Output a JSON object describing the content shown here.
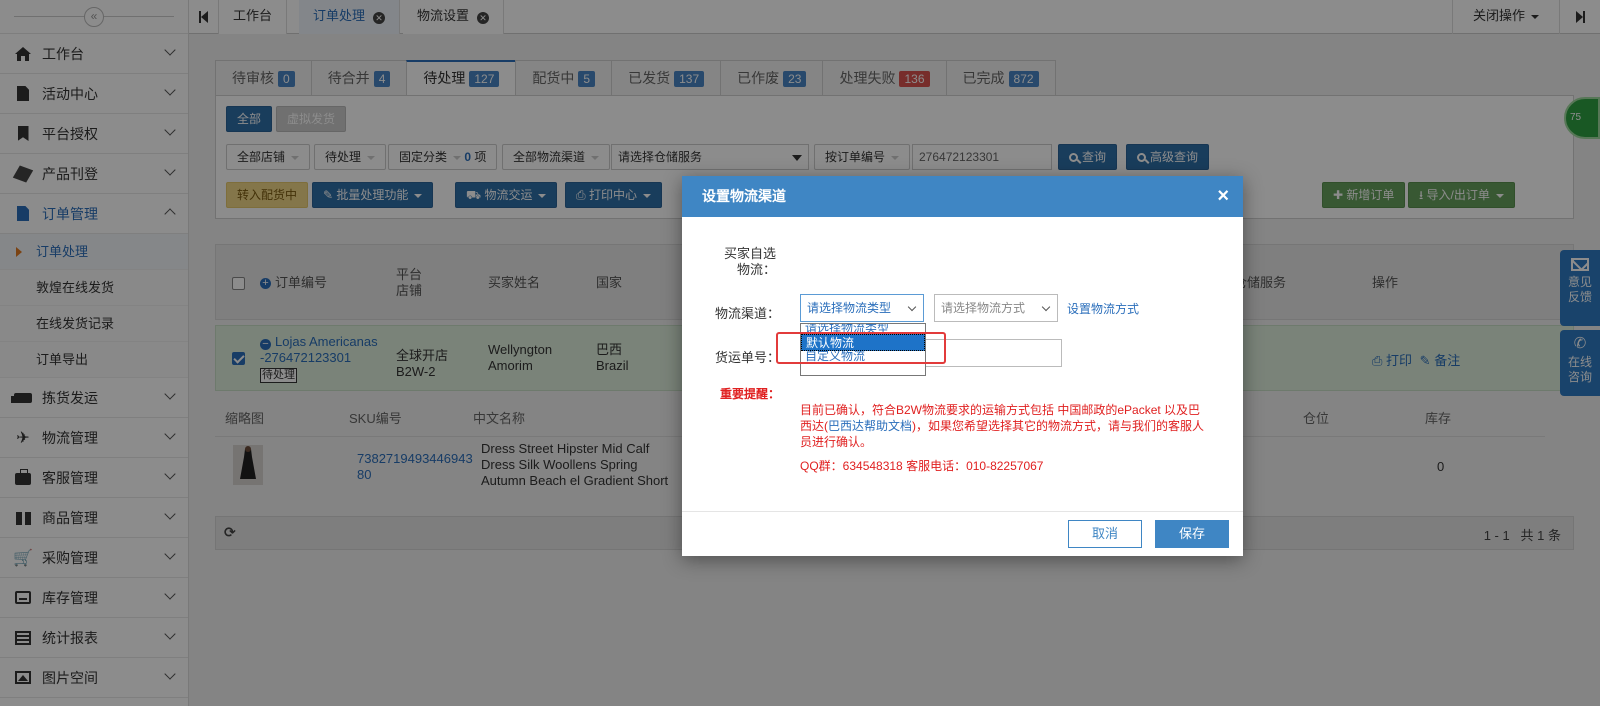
{
  "sidebar": {
    "items": [
      {
        "label": "工作台",
        "icon": "home-icon"
      },
      {
        "label": "活动中心",
        "icon": "document-icon"
      },
      {
        "label": "平台授权",
        "icon": "bookmark-icon"
      },
      {
        "label": "产品刊登",
        "icon": "cube-icon"
      },
      {
        "label": "订单管理",
        "icon": "document-icon"
      },
      {
        "label": "拣货发运",
        "icon": "truck-icon"
      },
      {
        "label": "物流管理",
        "icon": "plane-icon"
      },
      {
        "label": "客服管理",
        "icon": "briefcase-icon"
      },
      {
        "label": "商品管理",
        "icon": "gift-icon"
      },
      {
        "label": "采购管理",
        "icon": "cart-icon"
      },
      {
        "label": "库存管理",
        "icon": "inbox-icon"
      },
      {
        "label": "统计报表",
        "icon": "list-icon"
      },
      {
        "label": "图片空间",
        "icon": "image-icon"
      }
    ],
    "subitems": [
      "订单处理",
      "敦煌在线发货",
      "在线发货记录",
      "订单导出"
    ]
  },
  "topbar": {
    "tabs": [
      "工作台",
      "订单处理",
      "物流设置"
    ],
    "close_ops": "关闭操作"
  },
  "status_tabs": [
    {
      "label": "待审核",
      "count": "0"
    },
    {
      "label": "待合并",
      "count": "4"
    },
    {
      "label": "待处理",
      "count": "127"
    },
    {
      "label": "配货中",
      "count": "5"
    },
    {
      "label": "已发货",
      "count": "137"
    },
    {
      "label": "已作废",
      "count": "23"
    },
    {
      "label": "处理失败",
      "count": "136"
    },
    {
      "label": "已完成",
      "count": "872"
    }
  ],
  "filters": {
    "all": "全部",
    "virtual": "虚拟发货",
    "all_stores": "全部店铺",
    "pending": "待处理",
    "fixed_category": "固定分类",
    "fixed_count": "0",
    "fixed_unit": "项",
    "all_channels": "全部物流渠道",
    "warehouse": "请选择仓储服务",
    "by_order": "按订单编号",
    "order_value": "276472123301",
    "query": "查询",
    "advanced": "高级查询"
  },
  "actions": {
    "to_allocation": "转入配货中",
    "batch": "批量处理功能",
    "logistics": "物流交运",
    "print": "打印中心",
    "new_order": "新增订单",
    "import_export": "导入/出订单"
  },
  "table": {
    "headers": {
      "order_no": "订单编号",
      "platform": "平台\n店铺",
      "buyer": "买家姓名",
      "country": "国家",
      "warehouse": "仓储服务",
      "ops": "操作"
    },
    "row": {
      "store": "Lojas Americanas",
      "order_id": "-276472123301",
      "status": "待处理",
      "shop": "全球开店B2W-2",
      "buyer": "Wellyngton Amorim",
      "country_cn": "巴西",
      "country_en": "Brazil",
      "print": "打印",
      "note": "备注"
    },
    "sub_headers": {
      "thumb": "缩略图",
      "sku": "SKU编号",
      "name_cn": "中文名称",
      "location": "仓位",
      "stock": "库存"
    },
    "sku_row": {
      "sku": "738271949344694380",
      "name": "Dress Street Hipster Mid Calf Dress Silk Woollens Spring Autumn Beach el Gradient Short Sleeves",
      "stock": "0"
    },
    "pager": "1 - 1   共 1 条"
  },
  "float": {
    "circle": "75",
    "feedback": "意见反馈",
    "consult": "在线咨询"
  },
  "modal": {
    "title": "设置物流渠道",
    "buyer_choice_label": "买家自选物流：",
    "channel_label": "物流渠道：",
    "channel_type_placeholder": "请选择物流类型",
    "channel_method_placeholder": "请选择物流方式",
    "set_method_link": "设置物流方式",
    "dropdown_options": [
      "请选择物流类型",
      "默认物流",
      "自定义物流"
    ],
    "tracking_label": "货运单号：",
    "important_label": "重要提醒：",
    "notice_1": "目前已确认，符合B2W物流要求的运输方式包括 中国邮政的ePacket 以及巴西达(",
    "notice_link": "巴西达帮助文档",
    "notice_2": ")，如果您希望选择其它的物流方式，请与我们的客服人员进行确认。",
    "contact": "QQ群：634548318 客服电话：010-82257067",
    "cancel": "取消",
    "save": "保存"
  },
  "colors": {
    "primary": "#2f6fa8",
    "modal_header": "#3f86c4",
    "danger": "#e02020",
    "success": "#66a05d",
    "highlight": "#1e73c8"
  }
}
